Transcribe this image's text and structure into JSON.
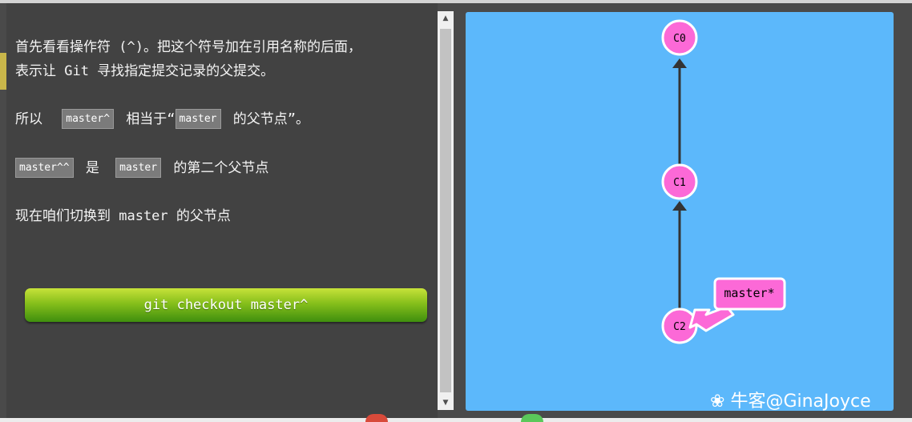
{
  "lesson": {
    "para1_line1": "首先看看操作符 (^)。把这个符号加在引用名称的后面，",
    "para1_line2": "表示让 Git 寻找指定提交记录的父提交。",
    "para2_prefix": "所以",
    "para2_code1": "master^",
    "para2_middle": "相当于“",
    "para2_code2": "master",
    "para2_suffix": "的父节点”。",
    "para3_code1": "master^^",
    "para3_middle": "是",
    "para3_code2": "master",
    "para3_suffix": "的第二个父节点",
    "para4": "现在咱们切换到 master 的父节点"
  },
  "command_button": {
    "label": "git checkout master^"
  },
  "graph": {
    "commits": [
      {
        "id": "C0"
      },
      {
        "id": "C1"
      },
      {
        "id": "C2"
      }
    ],
    "branch_label": "master*",
    "colors": {
      "background": "#5cb8fb",
      "commit_fill": "#fc69d7",
      "branch_fill": "#fc69d7",
      "edge": "#333333"
    }
  },
  "watermark": {
    "text": "牛客@GinaJoyce"
  },
  "icons": {
    "scroll_up": "scroll-up-arrow",
    "scroll_down": "scroll-down-arrow",
    "watermark_logo": "nowcoder-logo"
  }
}
